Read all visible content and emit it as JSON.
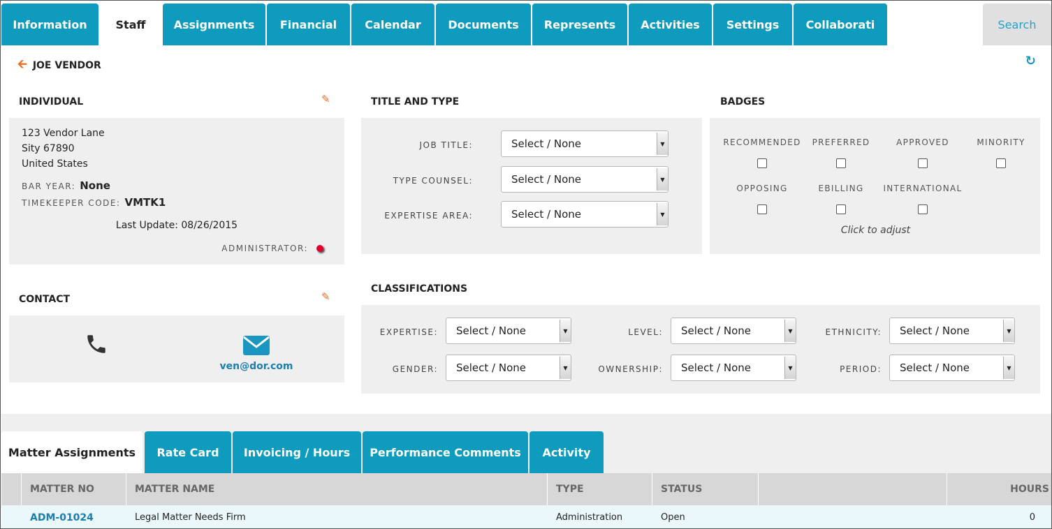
{
  "tabs": [
    "Information",
    "Staff",
    "Assignments",
    "Financial",
    "Calendar",
    "Documents",
    "Represents",
    "Activities",
    "Settings",
    "Collaborati"
  ],
  "search_label": "Search",
  "vendor_name": "JOE VENDOR",
  "individual": {
    "title": "INDIVIDUAL",
    "address_line1": "123 Vendor Lane",
    "address_line2": "Sity 67890",
    "address_line3": "United States",
    "bar_year_label": "BAR YEAR:",
    "bar_year_value": "None",
    "timekeeper_label": "TIMEKEEPER CODE:",
    "timekeeper_value": "VMTK1",
    "last_update": "Last Update: 08/26/2015",
    "administrator_label": "ADMINISTRATOR:"
  },
  "contact": {
    "title": "CONTACT",
    "email": "ven@dor.com"
  },
  "title_type": {
    "title": "TITLE AND TYPE",
    "job_title_label": "JOB TITLE:",
    "type_counsel_label": "TYPE COUNSEL:",
    "expertise_area_label": "EXPERTISE AREA:",
    "select_value": "Select / None"
  },
  "badges": {
    "title": "BADGES",
    "items": [
      "RECOMMENDED",
      "PREFERRED",
      "APPROVED",
      "MINORITY",
      "OPPOSING",
      "EBILLING",
      "INTERNATIONAL"
    ],
    "hint": "Click to adjust"
  },
  "classifications": {
    "title": "CLASSIFICATIONS",
    "expertise_label": "EXPERTISE:",
    "level_label": "LEVEL:",
    "ethnicity_label": "ETHNICITY:",
    "gender_label": "GENDER:",
    "ownership_label": "OWNERSHIP:",
    "period_label": "PERIOD:",
    "select_value": "Select / None"
  },
  "bottom_tabs": [
    "Matter Assignments",
    "Rate Card",
    "Invoicing / Hours",
    "Performance Comments",
    "Activity"
  ],
  "table": {
    "headers": [
      "MATTER NO",
      "MATTER NAME",
      "TYPE",
      "STATUS",
      "HOURS"
    ],
    "rows": [
      {
        "matter_no": "ADM-01024",
        "matter_name": "Legal Matter Needs Firm",
        "type": "Administration",
        "status": "Open",
        "hours": "0"
      }
    ]
  }
}
